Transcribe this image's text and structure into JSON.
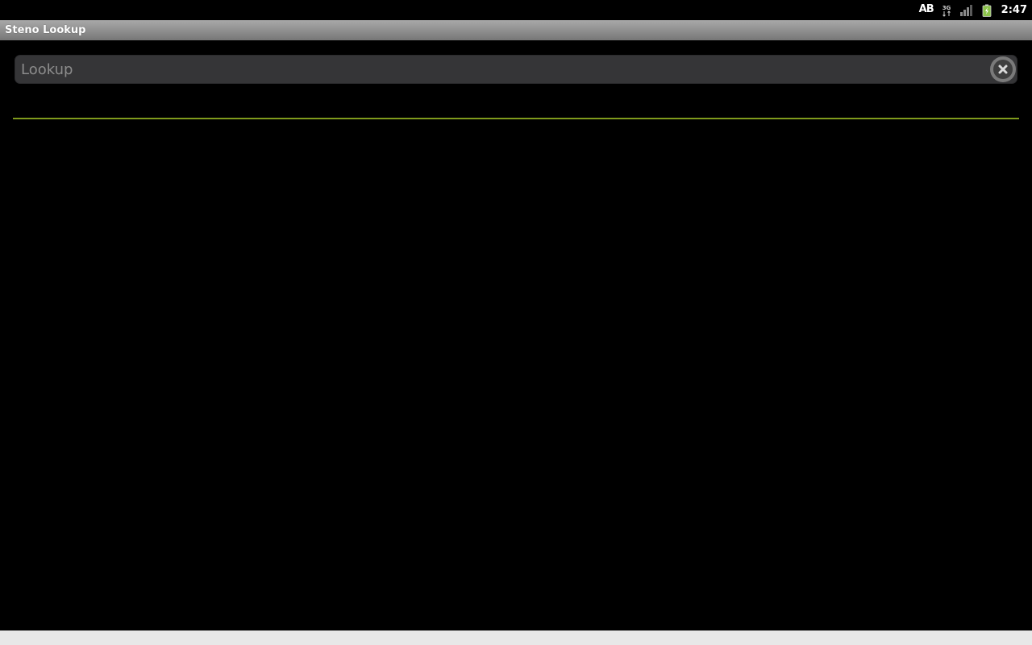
{
  "status_bar": {
    "input_method": "AB",
    "network_type": "3G",
    "time": "2:47",
    "icons": [
      "keyboard-ab-icon",
      "data-3g-icon",
      "signal-strength-icon",
      "battery-charging-icon"
    ]
  },
  "app": {
    "title": "Steno Lookup"
  },
  "search": {
    "placeholder": "Lookup",
    "value": ""
  },
  "colors": {
    "divider": "#7f9a1c",
    "battery": "#8bc34a"
  }
}
